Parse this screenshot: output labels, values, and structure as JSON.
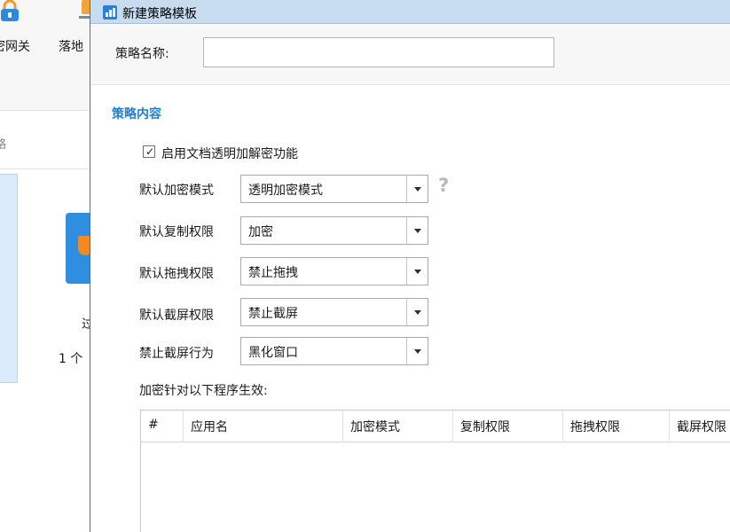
{
  "background_app": {
    "toolbar": [
      {
        "label": "密网关",
        "icon": "lock-icon"
      },
      {
        "label": "落地",
        "icon": "device-icon"
      }
    ],
    "strategy_fragment": "略",
    "list_fragments": [
      "过",
      "1 个"
    ]
  },
  "dialog": {
    "title": "新建策略模板",
    "name_label": "策略名称:",
    "name_value": "",
    "section_title": "策略内容",
    "enable_checkbox": {
      "label": "启用文档透明加解密功能",
      "checked": true
    },
    "fields": [
      {
        "label": "默认加密模式",
        "value": "透明加密模式"
      },
      {
        "label": "默认复制权限",
        "value": "加密"
      },
      {
        "label": "默认拖拽权限",
        "value": "禁止拖拽"
      },
      {
        "label": "默认截屏权限",
        "value": "禁止截屏"
      },
      {
        "label": "禁止截屏行为",
        "value": "黑化窗口"
      }
    ],
    "help_symbol": "?",
    "apply_label": "加密针对以下程序生效:",
    "table": {
      "columns": [
        "#",
        "应用名",
        "加密模式",
        "复制权限",
        "拖拽权限",
        "截屏权限"
      ],
      "rows": []
    }
  },
  "colors": {
    "titlebar": "#c8dcf0",
    "section_title": "#1f7fcf",
    "help_icon": "#b8b8b8",
    "app_icon": "#2b7fd6"
  }
}
